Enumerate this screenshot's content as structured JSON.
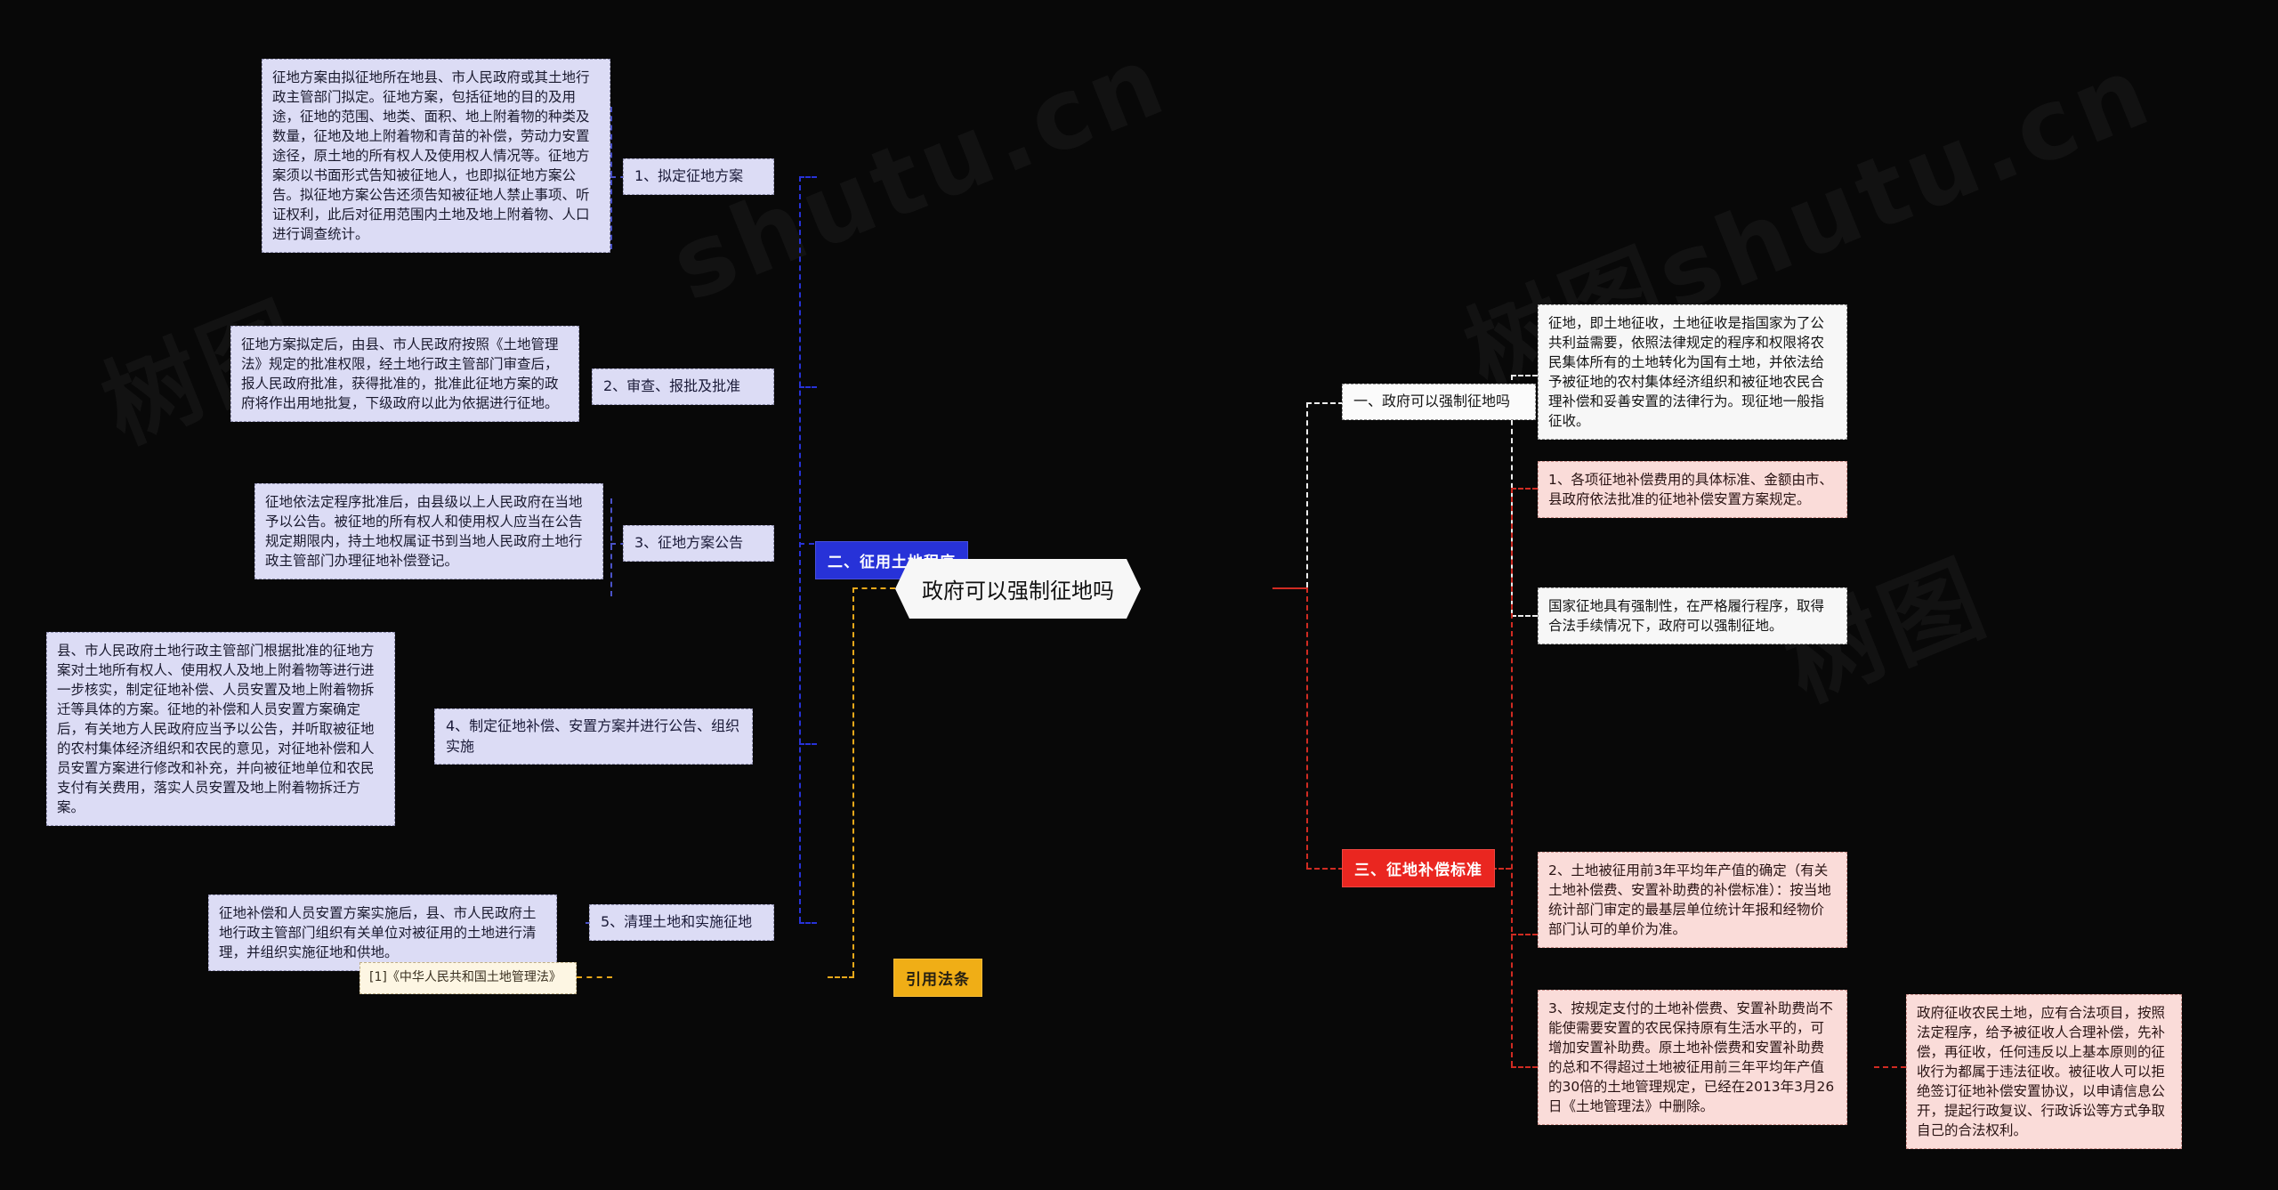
{
  "root": {
    "label": "政府可以强制征地吗"
  },
  "watermarks": [
    "树图",
    "shutu.cn",
    "树图shutu.cn",
    "树图"
  ],
  "categories": {
    "blue": {
      "label": "二、征用土地程序",
      "color": "#2732d8"
    },
    "white": {
      "label": "一、政府可以强制征地吗",
      "color": "#f7f7f7"
    },
    "red": {
      "label": "三、征地补偿标准",
      "color": "#ea2620"
    },
    "yellow": {
      "label": "引用法条",
      "color": "#f0ae16"
    }
  },
  "procedure_steps": [
    {
      "label": "1、拟定征地方案"
    },
    {
      "label": "2、审查、报批及批准"
    },
    {
      "label": "3、征地方案公告"
    },
    {
      "label": "4、制定征地补偿、安置方案并进行公告、组织实施"
    },
    {
      "label": "5、清理土地和实施征地"
    }
  ],
  "procedure_details": [
    {
      "text": "征地方案由拟征地所在地县、市人民政府或其土地行政主管部门拟定。征地方案，包括征地的目的及用途，征地的范围、地类、面积、地上附着物的种类及数量，征地及地上附着物和青苗的补偿，劳动力安置途径，原土地的所有权人及使用权人情况等。征地方案须以书面形式告知被征地人，也即拟征地方案公告。拟征地方案公告还须告知被征地人禁止事项、听证权利，此后对征用范围内土地及地上附着物、人口进行调查统计。"
    },
    {
      "text": "征地方案拟定后，由县、市人民政府按照《土地管理法》规定的批准权限，经土地行政主管部门审查后，报人民政府批准，获得批准的，批准此征地方案的政府将作出用地批复，下级政府以此为依据进行征地。"
    },
    {
      "text": "征地依法定程序批准后，由县级以上人民政府在当地予以公告。被征地的所有权人和使用权人应当在公告规定期限内，持土地权属证书到当地人民政府土地行政主管部门办理征地补偿登记。"
    },
    {
      "text": "县、市人民政府土地行政主管部门根据批准的征地方案对土地所有权人、使用权人及地上附着物等进行进一步核实，制定征地补偿、人员安置及地上附着物拆迁等具体的方案。征地的补偿和人员安置方案确定后，有关地方人民政府应当予以公告，并听取被征地的农村集体经济组织和农民的意见，对征地补偿和人员安置方案进行修改和补充，并向被征地单位和农民支付有关费用，落实人员安置及地上附着物拆迁方案。"
    },
    {
      "text": "征地补偿和人员安置方案实施后，县、市人民政府土地行政主管部门组织有关单位对被征用的土地进行清理，并组织实施征地和供地。"
    }
  ],
  "definition_items": [
    {
      "text": "征地，即土地征收，土地征收是指国家为了公共利益需要，依照法律规定的程序和权限将农民集体所有的土地转化为国有土地，并依法给予被征地的农村集体经济组织和被征地农民合理补偿和妥善安置的法律行为。现征地一般指征收。"
    },
    {
      "text": "国家征地具有强制性，在严格履行程序，取得合法手续情况下，政府可以强制征地。"
    }
  ],
  "compensation_items": [
    {
      "text": "1、各项征地补偿费用的具体标准、金额由市、县政府依法批准的征地补偿安置方案规定。"
    },
    {
      "text": "2、土地被征用前3年平均年产值的确定（有关土地补偿费、安置补助费的补偿标准）：按当地统计部门审定的最基层单位统计年报和经物价部门认可的单价为准。"
    },
    {
      "text": "3、按规定支付的土地补偿费、安置补助费尚不能使需要安置的农民保持原有生活水平的，可增加安置补助费。原土地补偿费和安置补助费的总和不得超过土地被征用前三年平均年产值的30倍的土地管理规定，已经在2013年3月26日《土地管理法》中删除。"
    }
  ],
  "compensation_note": {
    "text": "政府征收农民土地，应有合法项目，按照法定程序，给予被征收人合理补偿，先补偿，再征收，任何违反以上基本原则的征收行为都属于违法征收。被征收人可以拒绝签订征地补偿安置协议，以申请信息公开，提起行政复议、行政诉讼等方式争取自己的合法权利。"
  },
  "citation": {
    "text": "[1]《中华人民共和国土地管理法》"
  }
}
